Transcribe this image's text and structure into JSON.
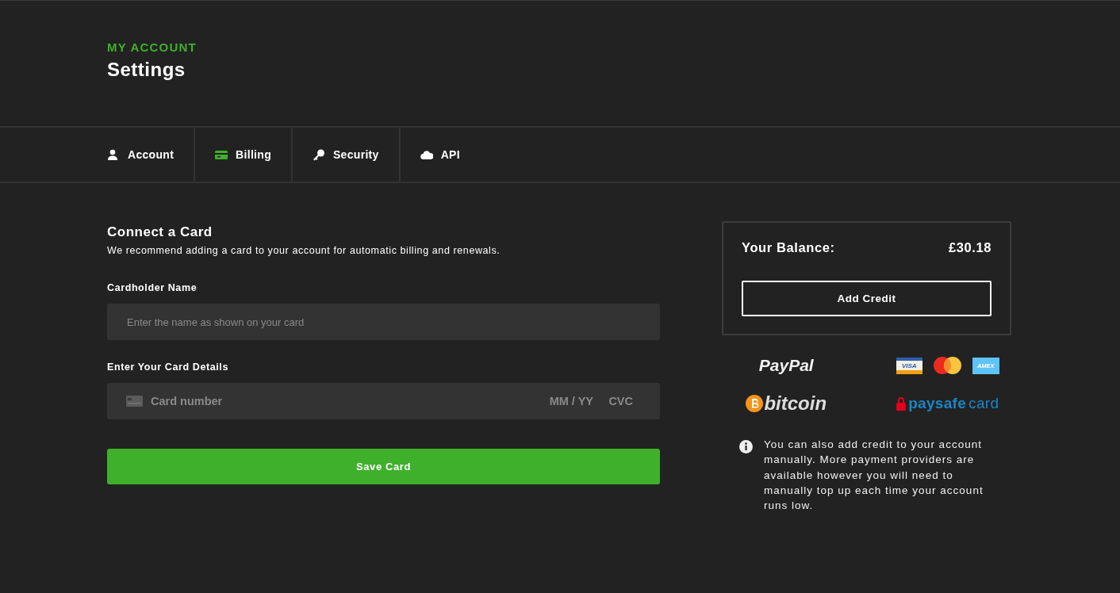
{
  "header": {
    "eyebrow": "MY ACCOUNT",
    "title": "Settings"
  },
  "tabs": [
    {
      "label": "Account",
      "selected": false
    },
    {
      "label": "Billing",
      "selected": true
    },
    {
      "label": "Security",
      "selected": false
    },
    {
      "label": "API",
      "selected": false
    }
  ],
  "card_form": {
    "title": "Connect a Card",
    "subtitle": "We recommend adding a card to your account for automatic billing and renewals.",
    "name_label": "Cardholder Name",
    "name_placeholder": "Enter the name as shown on your card",
    "details_label": "Enter Your Card Details",
    "number_placeholder": "Card number",
    "expiry_placeholder": "MM / YY",
    "cvc_placeholder": "CVC",
    "save_button": "Save Card"
  },
  "balance": {
    "label": "Your Balance:",
    "amount": "£30.18",
    "add_button": "Add Credit"
  },
  "payment_methods": [
    {
      "kind": "paypal",
      "text": "PayPal"
    },
    {
      "kind": "cards",
      "visa": "VISA",
      "amex": "AMEX"
    },
    {
      "kind": "bitcoin",
      "text": "bitcoin"
    },
    {
      "kind": "paysafecard",
      "text": "paysafe",
      "text_2": "card"
    }
  ],
  "info_note": "You can also add credit to your account manually. More payment providers are available however you will need to manually top up each time your account runs low."
}
